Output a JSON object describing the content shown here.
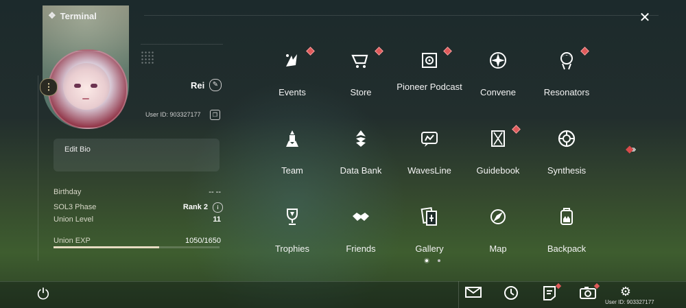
{
  "header": {
    "title": "Terminal",
    "close_icon": "close-icon"
  },
  "profile": {
    "name": "Rei",
    "user_id": "User ID: 903327177",
    "bio_label": "Edit Bio",
    "stats": [
      {
        "label": "Birthday",
        "value": "-- --"
      },
      {
        "label": "SOL3 Phase",
        "value": "Rank 2"
      },
      {
        "label": "Union Level",
        "value": "11"
      },
      {
        "label": "Union EXP",
        "value": "1050/1650"
      }
    ],
    "union_exp_progress": 0.636
  },
  "menu": [
    {
      "label": "Events",
      "icon": "events-icon",
      "badge": true
    },
    {
      "label": "Store",
      "icon": "store-cart-icon",
      "badge": true
    },
    {
      "label": "Pioneer Podcast",
      "icon": "podcast-icon",
      "badge": true
    },
    {
      "label": "Convene",
      "icon": "convene-icon",
      "badge": false
    },
    {
      "label": "Resonators",
      "icon": "resonators-icon",
      "badge": true
    },
    {
      "label": "Team",
      "icon": "team-icon",
      "badge": false
    },
    {
      "label": "Data Bank",
      "icon": "data-bank-icon",
      "badge": false
    },
    {
      "label": "WavesLine",
      "icon": "wavesline-icon",
      "badge": false
    },
    {
      "label": "Guidebook",
      "icon": "guidebook-icon",
      "badge": true
    },
    {
      "label": "Synthesis",
      "icon": "synthesis-icon",
      "badge": false
    },
    {
      "label": "Trophies",
      "icon": "trophy-icon",
      "badge": false
    },
    {
      "label": "Friends",
      "icon": "handshake-icon",
      "badge": false
    },
    {
      "label": "Gallery",
      "icon": "gallery-icon",
      "badge": false
    },
    {
      "label": "Map",
      "icon": "compass-icon",
      "badge": false
    },
    {
      "label": "Backpack",
      "icon": "backpack-icon",
      "badge": false
    }
  ],
  "pagination": {
    "pages": 2,
    "current": 1
  },
  "bottom_bar": {
    "icons": [
      "mail-icon",
      "clock-icon",
      "notice-icon",
      "camera-icon",
      "settings-icon"
    ],
    "user_id": "User ID: 903327177"
  },
  "colors": {
    "badge": "#e05a5a",
    "accent": "#e6dcc2"
  }
}
